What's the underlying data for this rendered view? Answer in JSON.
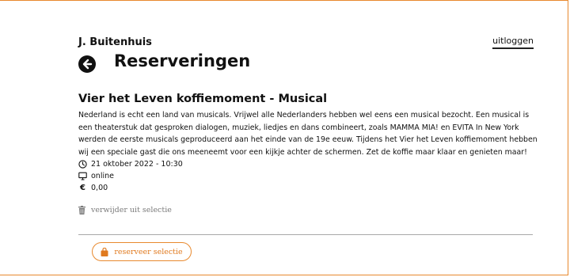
{
  "header": {
    "user_name": "J. Buitenhuis",
    "logout_label": "uitloggen",
    "page_title": "Reserveringen"
  },
  "event": {
    "title": "Vier het Leven koffiemoment - Musical",
    "description": "Nederland is echt een land van musicals. Vrijwel alle Nederlanders hebben wel eens een musical bezocht. Een musical is een theaterstuk dat gesproken dialogen, muziek, liedjes en dans combineert, zoals MAMMA MIA! en EVITA In New York werden de eerste musicals geproduceerd aan het einde van de 19e eeuw. Tijdens het Vier het Leven koffiemoment hebben wij een speciale gast die ons meeneemt voor een kijkje achter de schermen. Zet de koffie maar klaar en genieten maar!",
    "date": "21 oktober 2022 - 10:30",
    "location": "online",
    "currency_symbol": "€",
    "price": "0,00"
  },
  "actions": {
    "remove_label": "verwijder uit selectie",
    "reserve_label": "reserveer selectie"
  },
  "colors": {
    "accent": "#e8892e",
    "muted": "#7a7a7a",
    "divider": "#a8a8a8"
  },
  "icons": {
    "back": "arrow-left-circle-icon",
    "date": "clock-icon",
    "location": "monitor-icon",
    "price": "euro-icon",
    "remove": "trash-icon",
    "reserve": "shopping-bag-icon"
  }
}
